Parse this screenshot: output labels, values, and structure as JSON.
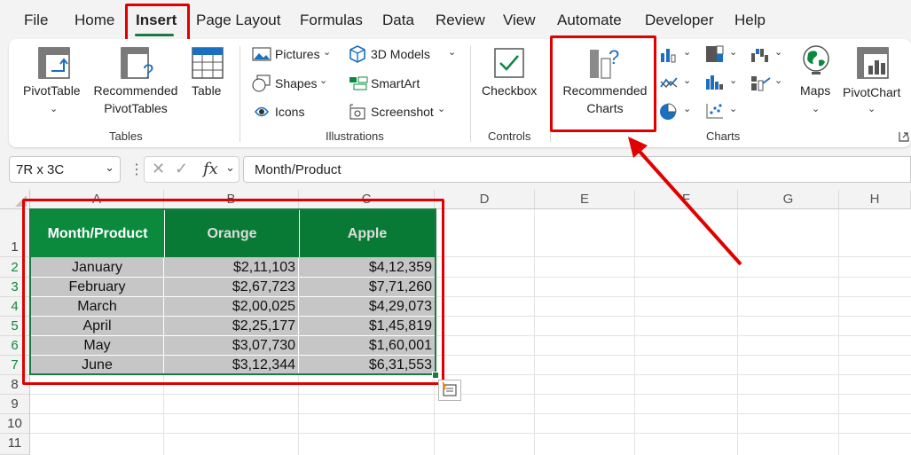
{
  "menu": [
    "File",
    "Home",
    "Insert",
    "Page Layout",
    "Formulas",
    "Data",
    "Review",
    "View",
    "Automate",
    "Developer",
    "Help"
  ],
  "ribbon": {
    "pivot_table": "PivotTable",
    "rec_pivot_1": "Recommended",
    "rec_pivot_2": "PivotTables",
    "table": "Table",
    "group_tables": "Tables",
    "pictures": "Pictures",
    "shapes": "Shapes",
    "icons": "Icons",
    "models_3d": "3D Models",
    "smartart": "SmartArt",
    "screenshot": "Screenshot",
    "group_illustrations": "Illustrations",
    "checkbox": "Checkbox",
    "group_controls": "Controls",
    "rec_charts_1": "Recommended",
    "rec_charts_2": "Charts",
    "group_charts": "Charts",
    "maps": "Maps",
    "pivot_chart": "PivotChart"
  },
  "formula_bar": {
    "name_box": "7R x 3C",
    "fx": "fx",
    "content": "Month/Product"
  },
  "columns": [
    "A",
    "B",
    "C",
    "D",
    "E",
    "F",
    "G",
    "H"
  ],
  "rows": [
    "1",
    "2",
    "3",
    "4",
    "5",
    "6",
    "7",
    "8",
    "9",
    "10",
    "11"
  ],
  "table": {
    "headers": [
      "Month/Product",
      "Orange",
      "Apple"
    ],
    "rows": [
      [
        "January",
        "$2,11,103",
        "$4,12,359"
      ],
      [
        "February",
        "$2,67,723",
        "$7,71,260"
      ],
      [
        "March",
        "$2,00,025",
        "$4,29,073"
      ],
      [
        "April",
        "$2,25,177",
        "$1,45,819"
      ],
      [
        "May",
        "$3,07,730",
        "$1,60,001"
      ],
      [
        "June",
        "$3,12,344",
        "$6,31,553"
      ]
    ]
  },
  "colors": {
    "header_green": "#0b8a3e",
    "header_dark_green": "#087a35",
    "body_gray": "#c6c6c6",
    "highlight_red": "#e00000",
    "accent_green": "#1b7a43"
  }
}
